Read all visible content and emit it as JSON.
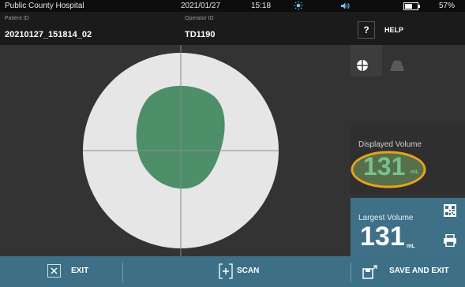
{
  "status": {
    "hospital": "Public County Hospital",
    "date": "2021/01/27",
    "time": "15:18",
    "battery": "57%"
  },
  "header": {
    "patient_label": "Patient ID",
    "patient_value": "20210127_151814_02",
    "operator_label": "Operator ID",
    "operator_value": "TD1190",
    "help_symbol": "?",
    "help_label": "HELP"
  },
  "scan": {
    "bladder_color": "#4c8f69",
    "field_color": "#e6e6e6"
  },
  "volume": {
    "displayed_label": "Displayed Volume",
    "displayed_value": "131",
    "displayed_unit": "mL",
    "largest_label": "Largest Volume",
    "largest_value": "131",
    "largest_unit": "mL",
    "highlight_color": "#e8a21c"
  },
  "bottom": {
    "exit_label": "EXIT",
    "scan_label": "SCAN",
    "save_label": "SAVE AND EXIT"
  },
  "icons": {
    "sun": "sun-icon",
    "speaker": "speaker-icon",
    "battery": "battery-icon",
    "crosshair": "crosshair-view-icon",
    "sector": "sector-view-icon",
    "barcode": "barcode-icon",
    "print": "printer-icon",
    "close": "close-icon",
    "scan": "scan-icon",
    "save": "save-icon"
  }
}
